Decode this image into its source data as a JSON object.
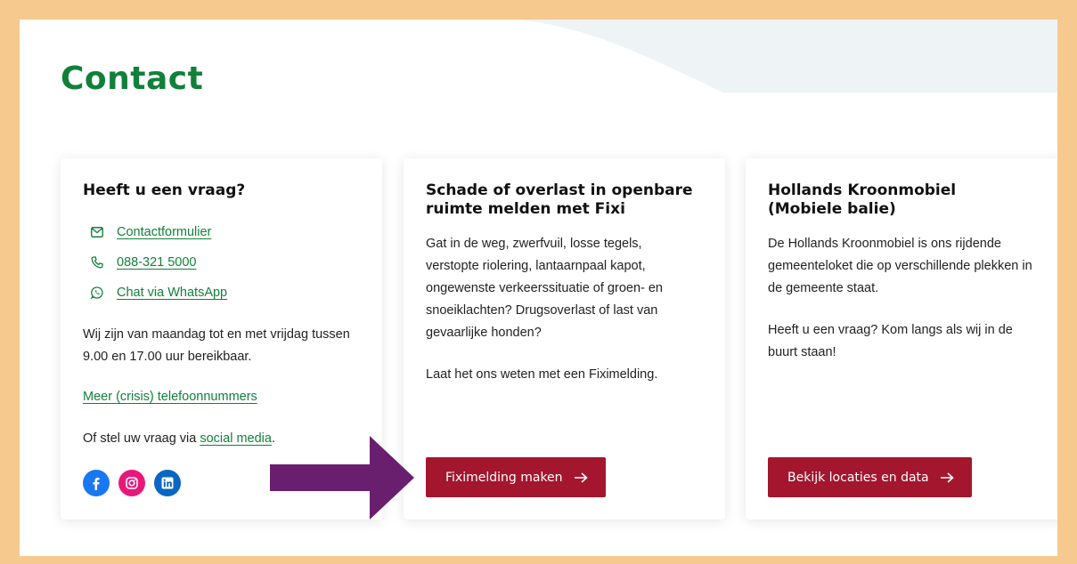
{
  "page": {
    "title": "Contact"
  },
  "colors": {
    "accent_green": "#11803a",
    "button_red": "#a3162e",
    "frame": "#f6c98f",
    "annotation_arrow": "#6a1f6e"
  },
  "cards": [
    {
      "title": "Heeft u een vraag?",
      "contacts": [
        {
          "icon": "mail-icon",
          "label": "Contactformulier"
        },
        {
          "icon": "phone-icon",
          "label": "088-321 5000"
        },
        {
          "icon": "whatsapp-icon",
          "label": "Chat via WhatsApp"
        }
      ],
      "hours": "Wij zijn van maandag tot en met vrijdag tussen 9.00 en 17.00 uur bereikbaar.",
      "crisis_link": "Meer (crisis) telefoonnummers",
      "social_prefix": "Of stel uw vraag via ",
      "social_link": "social media",
      "social_suffix": ".",
      "socials": [
        {
          "icon": "facebook-icon",
          "color": "#1877f2"
        },
        {
          "icon": "instagram-icon",
          "color": "#e1306c"
        },
        {
          "icon": "linkedin-icon",
          "color": "#0a66c2"
        }
      ]
    },
    {
      "title": "Schade of overlast in openbare ruimte melden met Fixi",
      "body": "Gat in de weg, zwerfvuil, losse tegels, verstopte riolering, lantaarnpaal kapot, ongewenste verkeerssituatie of groen- en snoeiklachten? Drugsoverlast of last van gevaarlijke honden?",
      "body2": "Laat het ons weten met een Fiximelding.",
      "button": "Fiximelding maken"
    },
    {
      "title": "Hollands Kroonmobiel (Mobiele balie)",
      "body": "De Hollands Kroonmobiel is ons rijdende gemeenteloket die op verschillende plekken in de gemeente staat.",
      "body2": "Heeft u een vraag? Kom langs als wij in de buurt staan!",
      "button": "Bekijk locaties en data"
    }
  ]
}
